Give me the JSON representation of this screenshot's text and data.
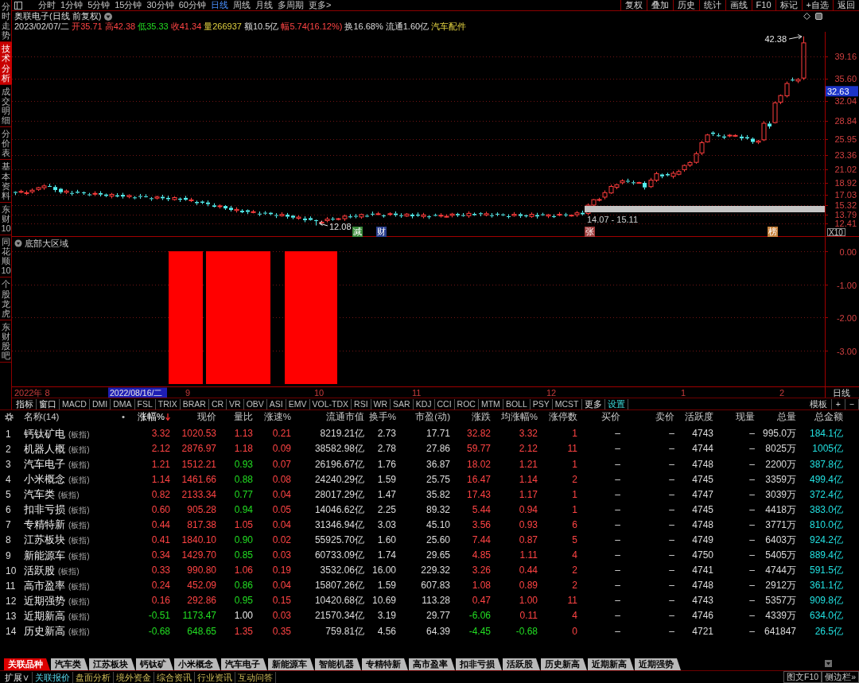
{
  "toolbar": {
    "periods": [
      {
        "label": "分时",
        "selected": false
      },
      {
        "label": "1分钟",
        "selected": false
      },
      {
        "label": "5分钟",
        "selected": false
      },
      {
        "label": "15分钟",
        "selected": false
      },
      {
        "label": "30分钟",
        "selected": false
      },
      {
        "label": "60分钟",
        "selected": false
      },
      {
        "label": "日线",
        "selected": true
      },
      {
        "label": "周线",
        "selected": false
      },
      {
        "label": "月线",
        "selected": false
      },
      {
        "label": "多周期",
        "selected": false
      },
      {
        "label": "更多>",
        "selected": false
      }
    ],
    "actions": [
      "复权",
      "叠加",
      "历史",
      "统计",
      "画线",
      "F10",
      "标记",
      "+自选",
      "返回"
    ]
  },
  "sidebar": {
    "tabs": [
      {
        "label": "分时走势",
        "selected": false
      },
      {
        "label": "技术分析",
        "selected": true
      },
      {
        "label": "成交明细",
        "selected": false
      },
      {
        "label": "分价表",
        "selected": false
      },
      {
        "label": "基本资料",
        "selected": false
      },
      {
        "label": "东财10",
        "selected": false
      },
      {
        "label": "同花顺10",
        "selected": false
      },
      {
        "label": "个股龙虎",
        "selected": false
      },
      {
        "label": "东财股吧",
        "selected": false
      }
    ]
  },
  "header": {
    "title": "奥联电子(日线 前复权)",
    "quotes": [
      {
        "text": "2023/02/07/二",
        "kind": "plain"
      },
      {
        "text": "开35.71",
        "kind": "up"
      },
      {
        "text": "高42.38",
        "kind": "up"
      },
      {
        "text": "低35.33",
        "kind": "down"
      },
      {
        "text": "收41.34",
        "kind": "up"
      },
      {
        "text": "量266937",
        "kind": "highlight"
      },
      {
        "text": "额10.5亿",
        "kind": "plain"
      },
      {
        "text": "幅5.74(16.12%)",
        "kind": "up"
      },
      {
        "text": "换16.68%",
        "kind": "plain"
      },
      {
        "text": "流通1.60亿",
        "kind": "plain"
      },
      {
        "text": "汽车配件",
        "kind": "highlight"
      }
    ]
  },
  "price_chart": {
    "price_axis": [
      "39.16",
      "35.60",
      "32.04",
      "28.84",
      "25.95",
      "23.36",
      "21.02",
      "18.92",
      "17.03",
      "15.32",
      "13.79",
      "12.41"
    ],
    "current_price": "32.63",
    "scale_label": "X10",
    "high_label": "42.38",
    "low_label": "12.08",
    "range_label": "14.07 - 15.11",
    "events": [
      {
        "label": "减",
        "color": "#3a8a3a"
      },
      {
        "label": "财",
        "color": "#2a3f8f"
      },
      {
        "label": "张",
        "color": "#a03c3c"
      },
      {
        "label": "榜",
        "color": "#c8823c"
      }
    ]
  },
  "indicator_panel": {
    "title": "底部大区域",
    "value_axis": [
      "0.00",
      "-1.00",
      "-2.00",
      "-3.00"
    ]
  },
  "date_axis": {
    "labels": [
      "2022年 8",
      "9",
      "10",
      "11",
      "12",
      "1",
      "2"
    ],
    "cursor_date": "2022/08/16/二",
    "period_label": "日线"
  },
  "indicator_tabs": {
    "items": [
      {
        "label": "指标",
        "kind": "menu"
      },
      {
        "label": "窗口",
        "kind": "menu"
      },
      {
        "label": "MACD",
        "kind": "indicator"
      },
      {
        "label": "DMI",
        "kind": "indicator"
      },
      {
        "label": "DMA",
        "kind": "indicator"
      },
      {
        "label": "FSL",
        "kind": "indicator"
      },
      {
        "label": "TRIX",
        "kind": "indicator"
      },
      {
        "label": "BRAR",
        "kind": "indicator"
      },
      {
        "label": "CR",
        "kind": "indicator"
      },
      {
        "label": "VR",
        "kind": "indicator"
      },
      {
        "label": "OBV",
        "kind": "indicator"
      },
      {
        "label": "ASI",
        "kind": "indicator"
      },
      {
        "label": "EMV",
        "kind": "indicator"
      },
      {
        "label": "VOL-TDX",
        "kind": "indicator"
      },
      {
        "label": "RSI",
        "kind": "indicator"
      },
      {
        "label": "WR",
        "kind": "indicator"
      },
      {
        "label": "SAR",
        "kind": "indicator"
      },
      {
        "label": "KDJ",
        "kind": "indicator"
      },
      {
        "label": "CCI",
        "kind": "indicator"
      },
      {
        "label": "ROC",
        "kind": "indicator"
      },
      {
        "label": "MTM",
        "kind": "indicator"
      },
      {
        "label": "BOLL",
        "kind": "indicator"
      },
      {
        "label": "PSY",
        "kind": "indicator"
      },
      {
        "label": "MCST",
        "kind": "indicator"
      },
      {
        "label": "更多",
        "kind": "menu"
      },
      {
        "label": "设置",
        "kind": "setting"
      }
    ],
    "right": [
      "模板",
      "+",
      "−"
    ]
  },
  "table": {
    "name_header": "名称(14)",
    "marker_header": "•",
    "columns": [
      {
        "label": "涨幅%",
        "sorted": true
      },
      {
        "label": "现价",
        "sorted": false
      },
      {
        "label": "量比",
        "sorted": false
      },
      {
        "label": "涨速%",
        "sorted": false
      },
      {
        "label": "流通市值",
        "sorted": false
      },
      {
        "label": "换手%",
        "sorted": false
      },
      {
        "label": "市盈(动)",
        "sorted": false
      },
      {
        "label": "涨跌",
        "sorted": false
      },
      {
        "label": "均涨幅%",
        "sorted": false
      },
      {
        "label": "涨停数",
        "sorted": false
      },
      {
        "label": "买价",
        "sorted": false
      },
      {
        "label": "卖价",
        "sorted": false
      },
      {
        "label": "活跃度",
        "sorted": false
      },
      {
        "label": "现量",
        "sorted": false
      },
      {
        "label": "总量",
        "sorted": false
      },
      {
        "label": "总金额",
        "sorted": false
      }
    ],
    "rows": [
      {
        "index": "1",
        "name": "钙钛矿电",
        "tag": "(板指)",
        "cells": [
          {
            "text": "3.32",
            "kind": "up"
          },
          {
            "text": "1020.53",
            "kind": "up"
          },
          {
            "text": "1.13",
            "kind": "up"
          },
          {
            "text": "0.21",
            "kind": "up"
          },
          {
            "text": "8219.21亿",
            "kind": "plain"
          },
          {
            "text": "2.73",
            "kind": "plain"
          },
          {
            "text": "17.71",
            "kind": "plain"
          },
          {
            "text": "32.82",
            "kind": "up"
          },
          {
            "text": "3.32",
            "kind": "up"
          },
          {
            "text": "1",
            "kind": "up"
          },
          {
            "text": "–",
            "kind": "plain"
          },
          {
            "text": "–",
            "kind": "plain"
          },
          {
            "text": "4743",
            "kind": "plain"
          },
          {
            "text": "–",
            "kind": "plain"
          },
          {
            "text": "995.0万",
            "kind": "plain"
          },
          {
            "text": "184.1亿",
            "kind": "amount"
          }
        ]
      },
      {
        "index": "2",
        "name": "机器人概",
        "tag": "(板指)",
        "cells": [
          {
            "text": "2.12",
            "kind": "up"
          },
          {
            "text": "2876.97",
            "kind": "up"
          },
          {
            "text": "1.18",
            "kind": "up"
          },
          {
            "text": "0.09",
            "kind": "up"
          },
          {
            "text": "38582.98亿",
            "kind": "plain"
          },
          {
            "text": "2.78",
            "kind": "plain"
          },
          {
            "text": "27.86",
            "kind": "plain"
          },
          {
            "text": "59.77",
            "kind": "up"
          },
          {
            "text": "2.12",
            "kind": "up"
          },
          {
            "text": "11",
            "kind": "up"
          },
          {
            "text": "–",
            "kind": "plain"
          },
          {
            "text": "–",
            "kind": "plain"
          },
          {
            "text": "4744",
            "kind": "plain"
          },
          {
            "text": "–",
            "kind": "plain"
          },
          {
            "text": "8025万",
            "kind": "plain"
          },
          {
            "text": "1005亿",
            "kind": "amount"
          }
        ]
      },
      {
        "index": "3",
        "name": "汽车电子",
        "tag": "(板指)",
        "cells": [
          {
            "text": "1.21",
            "kind": "up"
          },
          {
            "text": "1512.21",
            "kind": "up"
          },
          {
            "text": "0.93",
            "kind": "down"
          },
          {
            "text": "0.07",
            "kind": "up"
          },
          {
            "text": "26196.67亿",
            "kind": "plain"
          },
          {
            "text": "1.76",
            "kind": "plain"
          },
          {
            "text": "36.87",
            "kind": "plain"
          },
          {
            "text": "18.02",
            "kind": "up"
          },
          {
            "text": "1.21",
            "kind": "up"
          },
          {
            "text": "1",
            "kind": "up"
          },
          {
            "text": "–",
            "kind": "plain"
          },
          {
            "text": "–",
            "kind": "plain"
          },
          {
            "text": "4748",
            "kind": "plain"
          },
          {
            "text": "–",
            "kind": "plain"
          },
          {
            "text": "2200万",
            "kind": "plain"
          },
          {
            "text": "387.8亿",
            "kind": "amount"
          }
        ]
      },
      {
        "index": "4",
        "name": "小米概念",
        "tag": "(板指)",
        "cells": [
          {
            "text": "1.14",
            "kind": "up"
          },
          {
            "text": "1461.66",
            "kind": "up"
          },
          {
            "text": "0.88",
            "kind": "down"
          },
          {
            "text": "0.08",
            "kind": "up"
          },
          {
            "text": "24240.29亿",
            "kind": "plain"
          },
          {
            "text": "1.59",
            "kind": "plain"
          },
          {
            "text": "25.75",
            "kind": "plain"
          },
          {
            "text": "16.47",
            "kind": "up"
          },
          {
            "text": "1.14",
            "kind": "up"
          },
          {
            "text": "2",
            "kind": "up"
          },
          {
            "text": "–",
            "kind": "plain"
          },
          {
            "text": "–",
            "kind": "plain"
          },
          {
            "text": "4745",
            "kind": "plain"
          },
          {
            "text": "–",
            "kind": "plain"
          },
          {
            "text": "3359万",
            "kind": "plain"
          },
          {
            "text": "499.4亿",
            "kind": "amount"
          }
        ]
      },
      {
        "index": "5",
        "name": "汽车类",
        "tag": "(板指)",
        "cells": [
          {
            "text": "0.82",
            "kind": "up"
          },
          {
            "text": "2133.34",
            "kind": "up"
          },
          {
            "text": "0.77",
            "kind": "down"
          },
          {
            "text": "0.04",
            "kind": "up"
          },
          {
            "text": "28017.29亿",
            "kind": "plain"
          },
          {
            "text": "1.47",
            "kind": "plain"
          },
          {
            "text": "35.82",
            "kind": "plain"
          },
          {
            "text": "17.43",
            "kind": "up"
          },
          {
            "text": "1.17",
            "kind": "up"
          },
          {
            "text": "1",
            "kind": "up"
          },
          {
            "text": "–",
            "kind": "plain"
          },
          {
            "text": "–",
            "kind": "plain"
          },
          {
            "text": "4747",
            "kind": "plain"
          },
          {
            "text": "–",
            "kind": "plain"
          },
          {
            "text": "3039万",
            "kind": "plain"
          },
          {
            "text": "372.4亿",
            "kind": "amount"
          }
        ]
      },
      {
        "index": "6",
        "name": "扣非亏损",
        "tag": "(板指)",
        "cells": [
          {
            "text": "0.60",
            "kind": "up"
          },
          {
            "text": "905.28",
            "kind": "up"
          },
          {
            "text": "0.94",
            "kind": "down"
          },
          {
            "text": "0.05",
            "kind": "up"
          },
          {
            "text": "14046.62亿",
            "kind": "plain"
          },
          {
            "text": "2.25",
            "kind": "plain"
          },
          {
            "text": "89.32",
            "kind": "plain"
          },
          {
            "text": "5.44",
            "kind": "up"
          },
          {
            "text": "0.94",
            "kind": "up"
          },
          {
            "text": "1",
            "kind": "up"
          },
          {
            "text": "–",
            "kind": "plain"
          },
          {
            "text": "–",
            "kind": "plain"
          },
          {
            "text": "4745",
            "kind": "plain"
          },
          {
            "text": "–",
            "kind": "plain"
          },
          {
            "text": "4418万",
            "kind": "plain"
          },
          {
            "text": "383.0亿",
            "kind": "amount"
          }
        ]
      },
      {
        "index": "7",
        "name": "专精特新",
        "tag": "(板指)",
        "cells": [
          {
            "text": "0.44",
            "kind": "up"
          },
          {
            "text": "817.38",
            "kind": "up"
          },
          {
            "text": "1.05",
            "kind": "up"
          },
          {
            "text": "0.04",
            "kind": "up"
          },
          {
            "text": "31346.94亿",
            "kind": "plain"
          },
          {
            "text": "3.03",
            "kind": "plain"
          },
          {
            "text": "45.10",
            "kind": "plain"
          },
          {
            "text": "3.56",
            "kind": "up"
          },
          {
            "text": "0.93",
            "kind": "up"
          },
          {
            "text": "6",
            "kind": "up"
          },
          {
            "text": "–",
            "kind": "plain"
          },
          {
            "text": "–",
            "kind": "plain"
          },
          {
            "text": "4748",
            "kind": "plain"
          },
          {
            "text": "–",
            "kind": "plain"
          },
          {
            "text": "3771万",
            "kind": "plain"
          },
          {
            "text": "810.0亿",
            "kind": "amount"
          }
        ]
      },
      {
        "index": "8",
        "name": "江苏板块",
        "tag": "(板指)",
        "cells": [
          {
            "text": "0.41",
            "kind": "up"
          },
          {
            "text": "1840.10",
            "kind": "up"
          },
          {
            "text": "0.90",
            "kind": "down"
          },
          {
            "text": "0.02",
            "kind": "up"
          },
          {
            "text": "55925.70亿",
            "kind": "plain"
          },
          {
            "text": "1.60",
            "kind": "plain"
          },
          {
            "text": "25.60",
            "kind": "plain"
          },
          {
            "text": "7.44",
            "kind": "up"
          },
          {
            "text": "0.87",
            "kind": "up"
          },
          {
            "text": "5",
            "kind": "up"
          },
          {
            "text": "–",
            "kind": "plain"
          },
          {
            "text": "–",
            "kind": "plain"
          },
          {
            "text": "4749",
            "kind": "plain"
          },
          {
            "text": "–",
            "kind": "plain"
          },
          {
            "text": "6403万",
            "kind": "plain"
          },
          {
            "text": "924.2亿",
            "kind": "amount"
          }
        ]
      },
      {
        "index": "9",
        "name": "新能源车",
        "tag": "(板指)",
        "cells": [
          {
            "text": "0.34",
            "kind": "up"
          },
          {
            "text": "1429.70",
            "kind": "up"
          },
          {
            "text": "0.85",
            "kind": "down"
          },
          {
            "text": "0.03",
            "kind": "up"
          },
          {
            "text": "60733.09亿",
            "kind": "plain"
          },
          {
            "text": "1.74",
            "kind": "plain"
          },
          {
            "text": "29.65",
            "kind": "plain"
          },
          {
            "text": "4.85",
            "kind": "up"
          },
          {
            "text": "1.11",
            "kind": "up"
          },
          {
            "text": "4",
            "kind": "up"
          },
          {
            "text": "–",
            "kind": "plain"
          },
          {
            "text": "–",
            "kind": "plain"
          },
          {
            "text": "4750",
            "kind": "plain"
          },
          {
            "text": "–",
            "kind": "plain"
          },
          {
            "text": "5405万",
            "kind": "plain"
          },
          {
            "text": "889.4亿",
            "kind": "amount"
          }
        ]
      },
      {
        "index": "10",
        "name": "活跃股",
        "tag": "(板指)",
        "cells": [
          {
            "text": "0.33",
            "kind": "up"
          },
          {
            "text": "990.80",
            "kind": "up"
          },
          {
            "text": "1.06",
            "kind": "up"
          },
          {
            "text": "0.19",
            "kind": "up"
          },
          {
            "text": "3532.06亿",
            "kind": "plain"
          },
          {
            "text": "16.00",
            "kind": "plain"
          },
          {
            "text": "229.32",
            "kind": "plain"
          },
          {
            "text": "3.26",
            "kind": "up"
          },
          {
            "text": "0.44",
            "kind": "up"
          },
          {
            "text": "2",
            "kind": "up"
          },
          {
            "text": "–",
            "kind": "plain"
          },
          {
            "text": "–",
            "kind": "plain"
          },
          {
            "text": "4741",
            "kind": "plain"
          },
          {
            "text": "–",
            "kind": "plain"
          },
          {
            "text": "4744万",
            "kind": "plain"
          },
          {
            "text": "591.5亿",
            "kind": "amount"
          }
        ]
      },
      {
        "index": "11",
        "name": "高市盈率",
        "tag": "(板指)",
        "cells": [
          {
            "text": "0.24",
            "kind": "up"
          },
          {
            "text": "452.09",
            "kind": "up"
          },
          {
            "text": "0.86",
            "kind": "down"
          },
          {
            "text": "0.04",
            "kind": "up"
          },
          {
            "text": "15807.26亿",
            "kind": "plain"
          },
          {
            "text": "1.59",
            "kind": "plain"
          },
          {
            "text": "607.83",
            "kind": "plain"
          },
          {
            "text": "1.08",
            "kind": "up"
          },
          {
            "text": "0.89",
            "kind": "up"
          },
          {
            "text": "2",
            "kind": "up"
          },
          {
            "text": "–",
            "kind": "plain"
          },
          {
            "text": "–",
            "kind": "plain"
          },
          {
            "text": "4748",
            "kind": "plain"
          },
          {
            "text": "–",
            "kind": "plain"
          },
          {
            "text": "2912万",
            "kind": "plain"
          },
          {
            "text": "361.1亿",
            "kind": "amount"
          }
        ]
      },
      {
        "index": "12",
        "name": "近期强势",
        "tag": "(板指)",
        "cells": [
          {
            "text": "0.16",
            "kind": "up"
          },
          {
            "text": "292.86",
            "kind": "up"
          },
          {
            "text": "0.95",
            "kind": "down"
          },
          {
            "text": "0.15",
            "kind": "up"
          },
          {
            "text": "10420.68亿",
            "kind": "plain"
          },
          {
            "text": "10.69",
            "kind": "plain"
          },
          {
            "text": "113.28",
            "kind": "plain"
          },
          {
            "text": "0.47",
            "kind": "up"
          },
          {
            "text": "1.00",
            "kind": "up"
          },
          {
            "text": "11",
            "kind": "up"
          },
          {
            "text": "–",
            "kind": "plain"
          },
          {
            "text": "–",
            "kind": "plain"
          },
          {
            "text": "4743",
            "kind": "plain"
          },
          {
            "text": "–",
            "kind": "plain"
          },
          {
            "text": "5357万",
            "kind": "plain"
          },
          {
            "text": "909.8亿",
            "kind": "amount"
          }
        ]
      },
      {
        "index": "13",
        "name": "近期新高",
        "tag": "(板指)",
        "cells": [
          {
            "text": "-0.51",
            "kind": "down"
          },
          {
            "text": "1173.47",
            "kind": "down"
          },
          {
            "text": "1.00",
            "kind": "flat"
          },
          {
            "text": "0.03",
            "kind": "up"
          },
          {
            "text": "21570.34亿",
            "kind": "plain"
          },
          {
            "text": "3.19",
            "kind": "plain"
          },
          {
            "text": "29.77",
            "kind": "plain"
          },
          {
            "text": "-6.06",
            "kind": "down"
          },
          {
            "text": "0.11",
            "kind": "up"
          },
          {
            "text": "4",
            "kind": "up"
          },
          {
            "text": "–",
            "kind": "plain"
          },
          {
            "text": "–",
            "kind": "plain"
          },
          {
            "text": "4746",
            "kind": "plain"
          },
          {
            "text": "–",
            "kind": "plain"
          },
          {
            "text": "4339万",
            "kind": "plain"
          },
          {
            "text": "634.0亿",
            "kind": "amount"
          }
        ]
      },
      {
        "index": "14",
        "name": "历史新高",
        "tag": "(板指)",
        "cells": [
          {
            "text": "-0.68",
            "kind": "down"
          },
          {
            "text": "648.65",
            "kind": "down"
          },
          {
            "text": "1.35",
            "kind": "up"
          },
          {
            "text": "0.35",
            "kind": "up"
          },
          {
            "text": "759.81亿",
            "kind": "plain"
          },
          {
            "text": "4.56",
            "kind": "plain"
          },
          {
            "text": "64.39",
            "kind": "plain"
          },
          {
            "text": "-4.45",
            "kind": "down"
          },
          {
            "text": "-0.68",
            "kind": "down"
          },
          {
            "text": "0",
            "kind": "up"
          },
          {
            "text": "–",
            "kind": "plain"
          },
          {
            "text": "–",
            "kind": "plain"
          },
          {
            "text": "4721",
            "kind": "plain"
          },
          {
            "text": "–",
            "kind": "plain"
          },
          {
            "text": "641847",
            "kind": "plain"
          },
          {
            "text": "26.5亿",
            "kind": "amount"
          }
        ]
      }
    ]
  },
  "category_tabs": [
    {
      "label": "关联品种",
      "selected": true
    },
    {
      "label": "汽车类",
      "selected": false
    },
    {
      "label": "江苏板块",
      "selected": false
    },
    {
      "label": "钙钛矿",
      "selected": false
    },
    {
      "label": "小米概念",
      "selected": false
    },
    {
      "label": "汽车电子",
      "selected": false
    },
    {
      "label": "新能源车",
      "selected": false
    },
    {
      "label": "智能机器",
      "selected": false
    },
    {
      "label": "专精特新",
      "selected": false
    },
    {
      "label": "高市盈率",
      "selected": false
    },
    {
      "label": "扣非亏损",
      "selected": false
    },
    {
      "label": "活跃股",
      "selected": false
    },
    {
      "label": "历史新高",
      "selected": false
    },
    {
      "label": "近期新高",
      "selected": false
    },
    {
      "label": "近期强势",
      "selected": false
    }
  ],
  "status_bar": {
    "expand_toggle": "扩展∨",
    "tabs": [
      {
        "label": "关联报价",
        "selected": true
      },
      {
        "label": "盘面分析",
        "selected": false
      },
      {
        "label": "境外资金",
        "selected": false
      },
      {
        "label": "综合资讯",
        "selected": false
      },
      {
        "label": "行业资讯",
        "selected": false
      },
      {
        "label": "互动问答",
        "selected": false
      }
    ],
    "right": [
      "图文F10",
      "侧边栏»"
    ]
  }
}
